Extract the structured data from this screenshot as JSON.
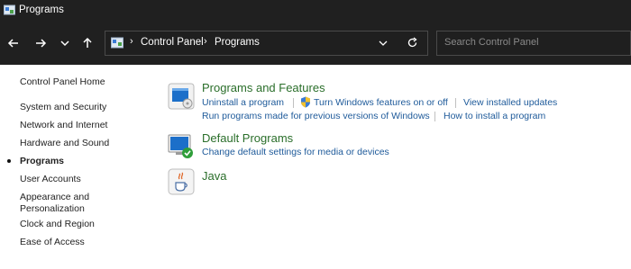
{
  "window": {
    "title": "Programs"
  },
  "address": {
    "crumbs": [
      "Control Panel",
      "Programs"
    ],
    "search_placeholder": "Search Control Panel"
  },
  "sidebar": {
    "items": [
      {
        "label": "Control Panel Home"
      },
      {
        "label": "System and Security"
      },
      {
        "label": "Network and Internet"
      },
      {
        "label": "Hardware and Sound"
      },
      {
        "label": "Programs",
        "active": true
      },
      {
        "label": "User Accounts"
      },
      {
        "label": "Appearance and"
      },
      {
        "label": "Personalization"
      },
      {
        "label": "Clock and Region"
      },
      {
        "label": "Ease of Access"
      }
    ]
  },
  "categories": {
    "programs_features": {
      "title": "Programs and Features",
      "links": [
        "Uninstall a program",
        "Turn Windows features on or off",
        "View installed updates",
        "Run programs made for previous versions of Windows",
        "How to install a program"
      ]
    },
    "default_programs": {
      "title": "Default Programs",
      "links": [
        "Change default settings for media or devices"
      ]
    },
    "java": {
      "title": "Java"
    }
  },
  "colors": {
    "titlebar": "#202020",
    "link": "#1e5a9a",
    "category": "#2a6e2a"
  }
}
